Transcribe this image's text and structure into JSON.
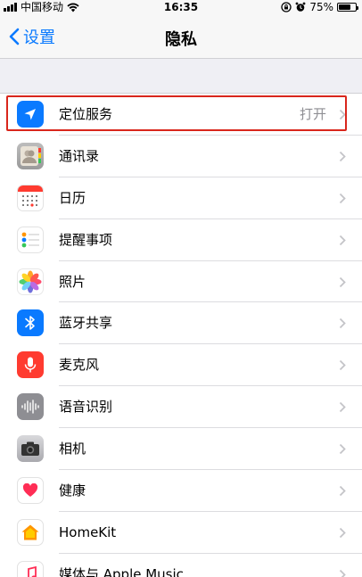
{
  "status_bar": {
    "carrier": "中国移动",
    "time": "16:35",
    "battery_percent": "75%",
    "battery_level": 0.75,
    "icons": [
      "signal-icon",
      "wifi-icon",
      "orientation-lock-icon",
      "alarm-icon",
      "battery-icon"
    ]
  },
  "nav": {
    "back_label": "设置",
    "title": "隐私"
  },
  "accent_color": "#0a7aff",
  "highlight_color": "#d9261c",
  "rows": [
    {
      "label": "定位服务",
      "value": "打开",
      "icon": "location-arrow-icon",
      "color": "#0a7aff",
      "highlighted": true
    },
    {
      "label": "通讯录",
      "value": "",
      "icon": "contacts-icon",
      "color": "#9e9e9e"
    },
    {
      "label": "日历",
      "value": "",
      "icon": "calendar-icon",
      "color": "#ffffff"
    },
    {
      "label": "提醒事项",
      "value": "",
      "icon": "reminders-icon",
      "color": "#ffffff"
    },
    {
      "label": "照片",
      "value": "",
      "icon": "photos-icon",
      "color": "#ffffff"
    },
    {
      "label": "蓝牙共享",
      "value": "",
      "icon": "bluetooth-icon",
      "color": "#0a7aff"
    },
    {
      "label": "麦克风",
      "value": "",
      "icon": "microphone-icon",
      "color": "#ff3b30"
    },
    {
      "label": "语音识别",
      "value": "",
      "icon": "speech-recognition-icon",
      "color": "#8e8e93"
    },
    {
      "label": "相机",
      "value": "",
      "icon": "camera-icon",
      "color": "#8e8e93"
    },
    {
      "label": "健康",
      "value": "",
      "icon": "health-heart-icon",
      "color": "#ffffff"
    },
    {
      "label": "HomeKit",
      "value": "",
      "icon": "homekit-house-icon",
      "color": "#ffffff"
    },
    {
      "label": "媒体与 Apple Music",
      "value": "",
      "icon": "music-note-icon",
      "color": "#ffffff"
    }
  ]
}
